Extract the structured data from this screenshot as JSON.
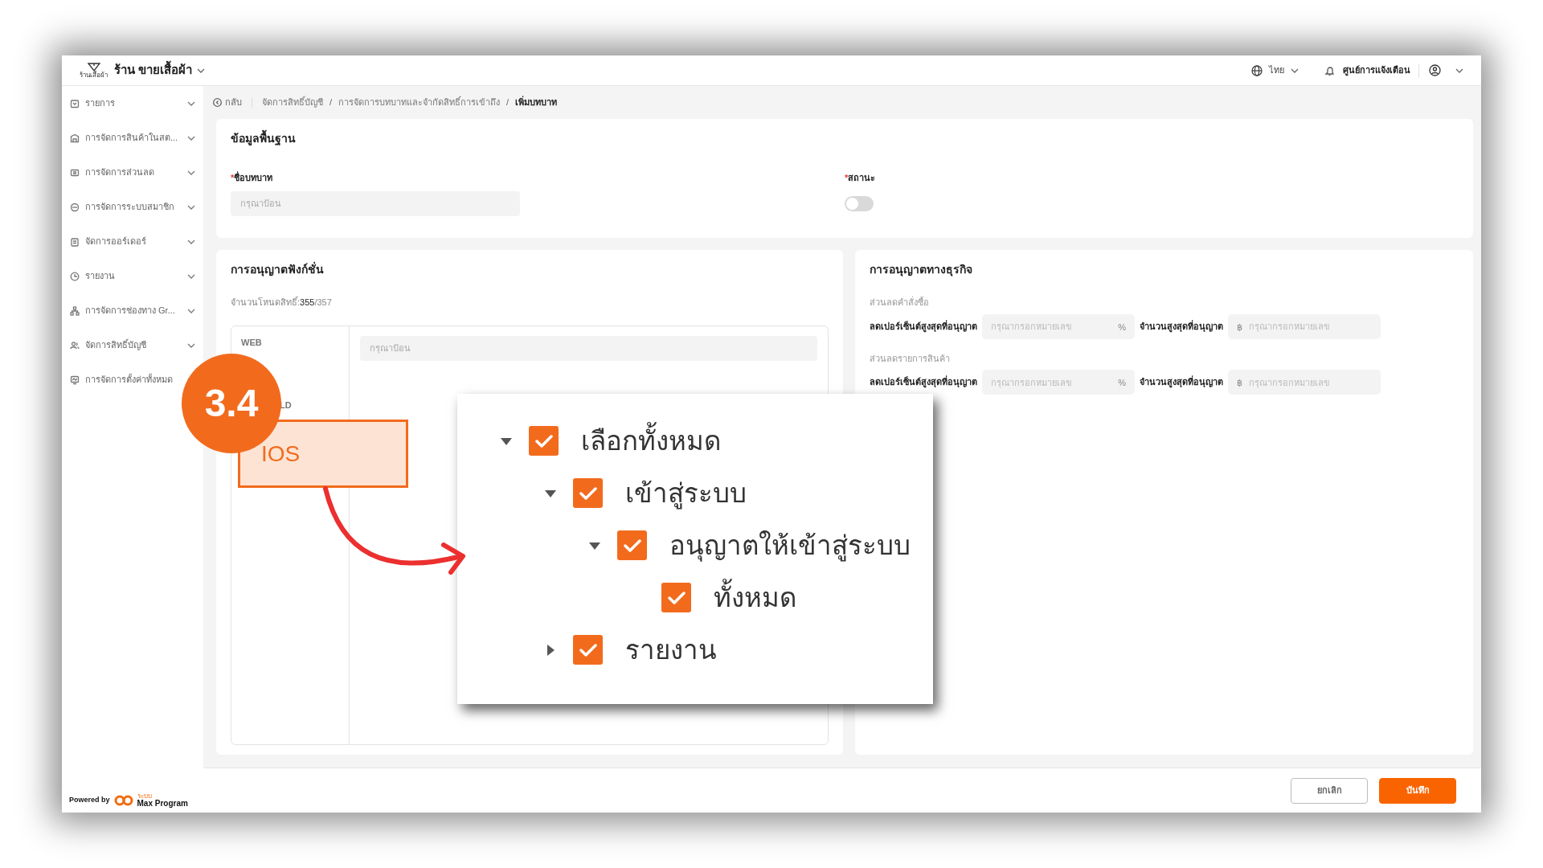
{
  "header": {
    "logo_caption": "ร้านเสื้อผ้า",
    "shop_name": "ร้าน ขายเสื้อผ้า",
    "language": "ไทย",
    "notifications": "ศูนย์การแจ้งเตือน"
  },
  "sidebar": {
    "items": [
      {
        "label": "รายการ"
      },
      {
        "label": "การจัดการสินค้าในสต..."
      },
      {
        "label": "การจัดการส่วนลด"
      },
      {
        "label": "การจัดการระบบสมาชิก"
      },
      {
        "label": "จัดการออร์เดอร์"
      },
      {
        "label": "รายงาน"
      },
      {
        "label": "การจัดการช่องทาง Gr..."
      },
      {
        "label": "จัดการสิทธิ์บัญชี"
      },
      {
        "label": "การจัดการตั้งค่าทั้งหมด"
      }
    ],
    "powered_by": "Powered by",
    "brand_tag": "ระบบ",
    "brand": "Max Program"
  },
  "breadcrumb": {
    "back": "กลับ",
    "separator": "/",
    "items": [
      "จัดการสิทธิ์บัญชี",
      "การจัดการบทบาทและจำกัดสิทธิ์การเข้าถึง",
      "เพิ่มบทบาท"
    ]
  },
  "basic_info": {
    "title": "ข้อมูลพื้นฐาน",
    "fields": [
      {
        "kind": "text",
        "required_mark": "*",
        "label": "ชื่อบทบาท",
        "placeholder": "กรุณาป้อน"
      },
      {
        "kind": "toggle",
        "required_mark": "*",
        "label": "สถานะ",
        "on": false
      }
    ]
  },
  "function_permissions": {
    "title": "การอนุญาตฟังก์ชั่น",
    "count_label": "จำนวนโหนดสิทธิ์:",
    "count": "355",
    "total": "/357",
    "platforms": [
      "WEB",
      "LD"
    ],
    "search": {
      "placeholder": "กรุณาป้อน"
    }
  },
  "business_permissions": {
    "title": "การอนุญาตทางธุรกิจ",
    "groups": [
      {
        "title": "ส่วนลดคำสั่งซื้อ",
        "fields": [
          {
            "kind": "suffix",
            "label": "ลดเปอร์เซ็นต์สูงสุดที่อนุญาต",
            "placeholder": "กรุณากรอกหมายเลข",
            "unit": "%"
          },
          {
            "kind": "prefix",
            "label": "จำนวนสูงสุดที่อนุญาต",
            "placeholder": "กรุณากรอกหมายเลข",
            "unit": "฿"
          }
        ]
      },
      {
        "title": "ส่วนลดรายการสินค้า",
        "fields": [
          {
            "kind": "suffix",
            "label": "ลดเปอร์เซ็นต์สูงสุดที่อนุญาต",
            "placeholder": "กรุณากรอกหมายเลข",
            "unit": "%"
          },
          {
            "kind": "prefix",
            "label": "จำนวนสูงสุดที่อนุญาต",
            "placeholder": "กรุณากรอกหมายเลข",
            "unit": "฿"
          }
        ]
      }
    ]
  },
  "footer": {
    "buttons": [
      {
        "kind": "secondary",
        "label": "ยกเลิก"
      },
      {
        "kind": "primary",
        "label": "บันทึก"
      }
    ]
  },
  "annotation": {
    "step": "3.4",
    "highlight": "IOS",
    "tree": [
      {
        "label": "เลือกทั้งหมด",
        "checked": true,
        "expanded": true,
        "children": [
          {
            "label": "เข้าสู่ระบบ",
            "checked": true,
            "expanded": true,
            "children": [
              {
                "label": "อนุญาตให้เข้าสู่ระบบ",
                "checked": true,
                "expanded": true,
                "children": [
                  {
                    "label": "ทั้งหมด",
                    "checked": true
                  }
                ]
              }
            ]
          },
          {
            "label": "รายงาน",
            "checked": true,
            "expanded": false
          }
        ]
      }
    ]
  }
}
